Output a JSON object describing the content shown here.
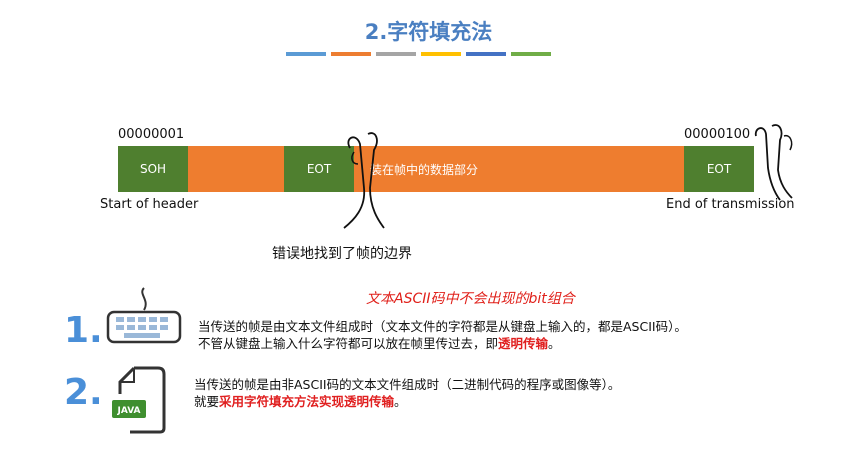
{
  "title": "2.字符填充法",
  "title_bar_colors": [
    "#5b9bd5",
    "#ed7d31",
    "#a5a5a5",
    "#ffc000",
    "#4472c4",
    "#70ad47"
  ],
  "frame": {
    "bits_left": "00000001",
    "bits_right": "00000100",
    "seg_soh": "SOH",
    "seg_eot_mid": "EOT",
    "seg_data": "装在帧中的数据部分",
    "seg_eot_end": "EOT",
    "caption_left": "Start of header",
    "caption_right": "End of transmission",
    "error_label": "错误地找到了帧的边界"
  },
  "note": "文本ASCII码中不会出现的bit组合",
  "items": [
    {
      "number": "1.",
      "icon": "keyboard-icon",
      "line1": "当传送的帧是由文本文件组成时（文本文件的字符都是从键盘上输入的，都是ASCII码）。",
      "line2_prefix": "不管从键盘上输入什么字符都可以放在帧里传过去，即",
      "line2_highlight": "透明传输",
      "line2_suffix": "。"
    },
    {
      "number": "2.",
      "icon": "java-file-icon",
      "icon_label": "JAVA",
      "line1": "当传送的帧是由非ASCII码的文本文件组成时（二进制代码的程序或图像等）。",
      "line2_prefix": "就要",
      "line2_highlight": "采用字符填充方法实现透明传输",
      "line2_suffix": "。"
    }
  ]
}
